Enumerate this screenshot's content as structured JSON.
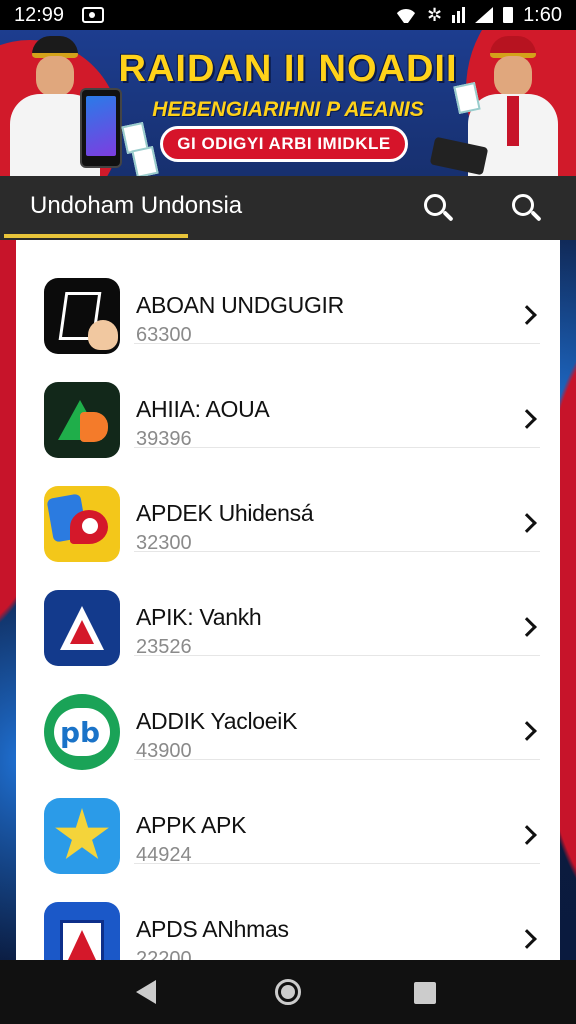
{
  "status_bar": {
    "time_left": "12:99",
    "time_right": "1:60"
  },
  "banner": {
    "title": "RAIDAN II NOADII",
    "subtitle": "HEBENGIARIHNI P AEANIS",
    "pill_text": "GI ODIGYI ARBI IMIDKLE"
  },
  "header": {
    "title": "Undoham Undonsia",
    "search_icon_1": "search-icon",
    "search_icon_2": "search-icon"
  },
  "apps": [
    {
      "name": "ABOAN UNDGUGIR",
      "count": "63300"
    },
    {
      "name": "AHIIA: AOUA",
      "count": "39396"
    },
    {
      "name": "APDEK Uhidensá",
      "count": "32300"
    },
    {
      "name": "APIK: Vankh",
      "count": "23526"
    },
    {
      "name": "ADDIK YacloeiK",
      "count": "43900"
    },
    {
      "name": "APPK APK",
      "count": "44924"
    },
    {
      "name": "APDS ANhmas",
      "count": "22200"
    }
  ],
  "nav": {
    "back": "back-icon",
    "home": "home-icon",
    "recents": "recents-icon"
  }
}
